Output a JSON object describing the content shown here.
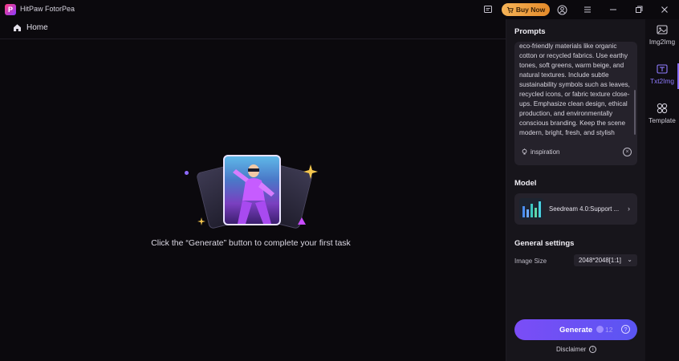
{
  "window": {
    "app_name": "HitPaw FotorPea",
    "logo_letter": "P",
    "buy_now_label": "Buy Now"
  },
  "nav": {
    "home_label": "Home"
  },
  "empty_state": {
    "message": "Click the “Generate” button to complete your first task"
  },
  "panel": {
    "prompts_title": "Prompts",
    "prompt_text": "eco-friendly materials like organic cotton or recycled fabrics. Use earthy tones, soft greens, warm beige, and natural textures. Include subtle sustainability symbols such as leaves, recycled icons, or fabric texture close-ups. Emphasize clean design, ethical production, and environmentally conscious branding. Keep the scene modern, bright, fresh, and stylish",
    "inspiration_label": "inspiration",
    "model_title": "Model",
    "model_name": "Seedream 4.0:Support ...",
    "general_settings_title": "General settings",
    "image_size_label": "Image Size",
    "image_size_value": "2048*2048[1:1]",
    "generate_label": "Generate",
    "generate_cost": "12",
    "disclaimer_label": "Disclaimer"
  },
  "rail": {
    "items": [
      {
        "label": "Img2Img",
        "icon": "image-icon",
        "active": false
      },
      {
        "label": "Txt2Img",
        "icon": "text-image-icon",
        "active": true
      },
      {
        "label": "Template",
        "icon": "template-icon",
        "active": false
      }
    ]
  },
  "colors": {
    "accent": "#7b4df6",
    "buy_now": "#f5b357",
    "active_tab": "#8f7bff",
    "background": "#0b090d"
  }
}
